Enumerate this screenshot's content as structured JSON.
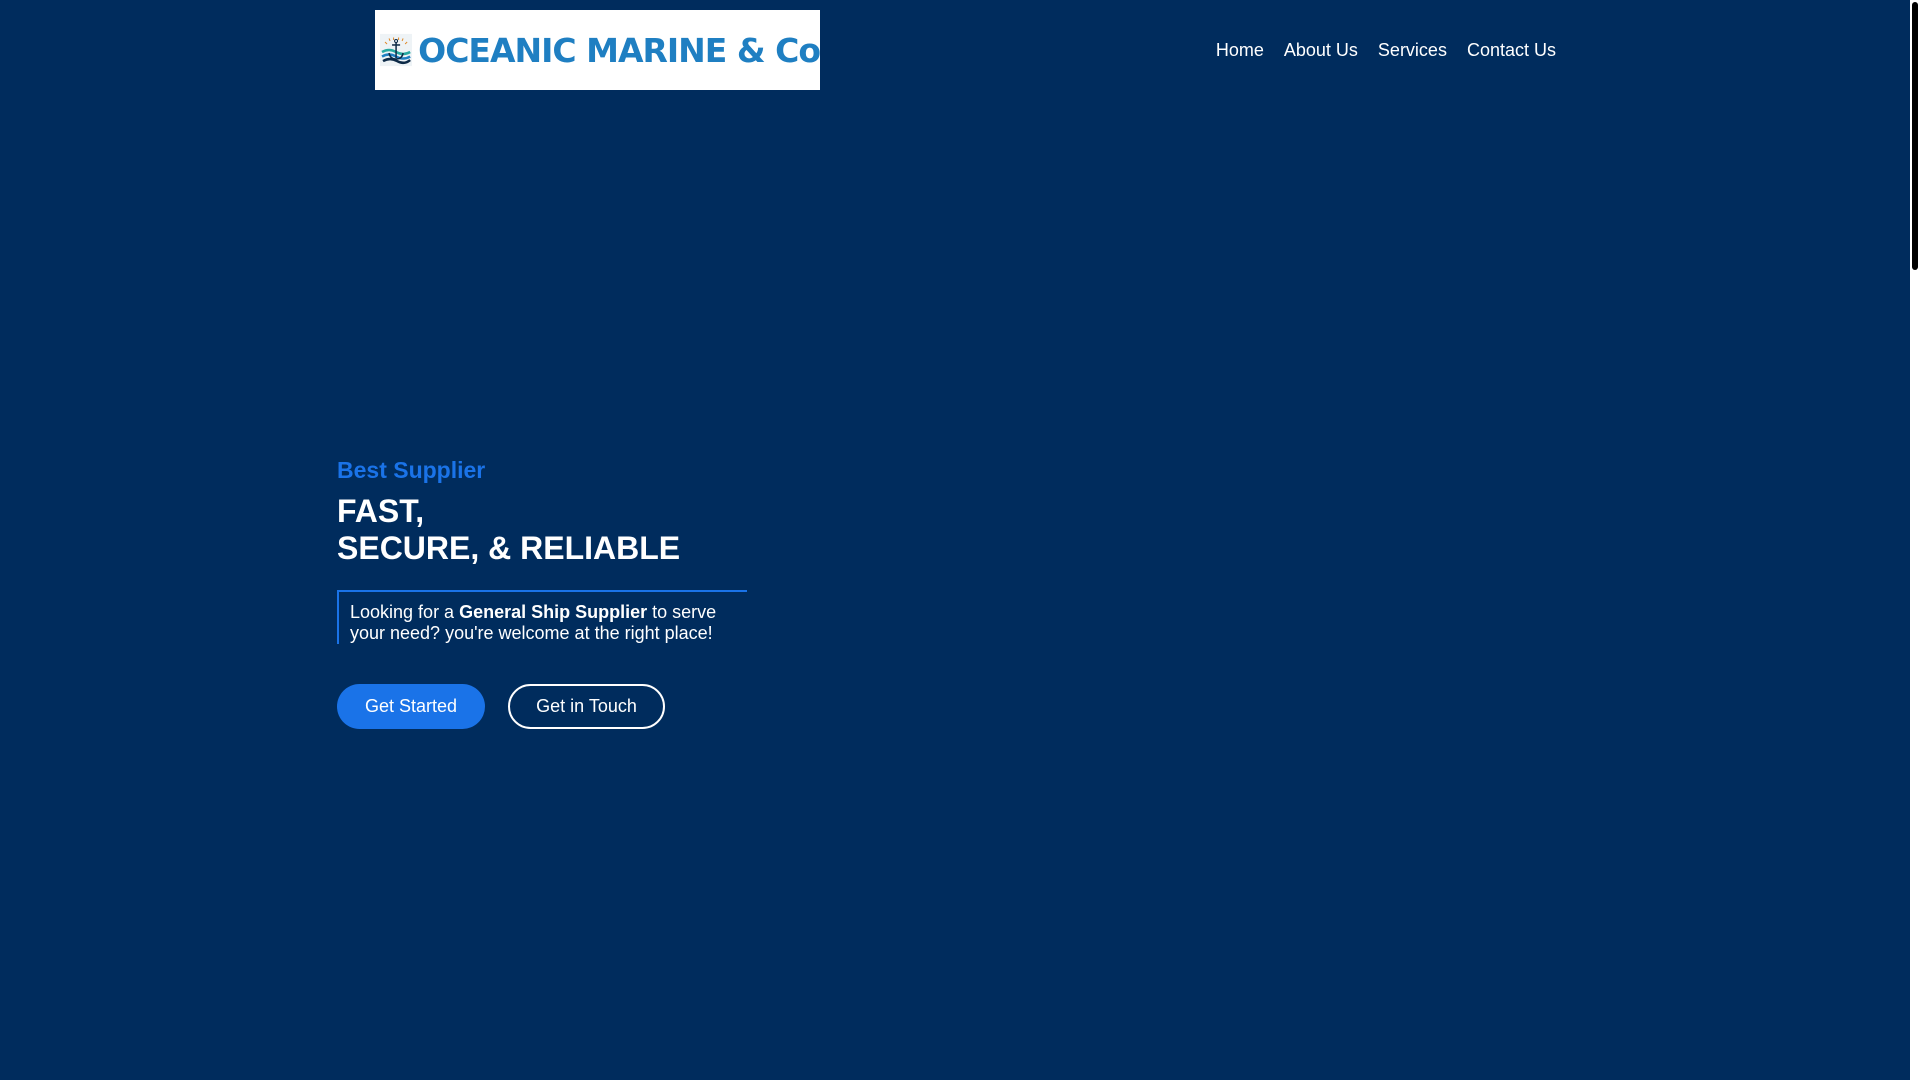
{
  "header": {
    "logo_text": "OCEANIC MARINE & Co",
    "nav": [
      {
        "label": "Home"
      },
      {
        "label": "About Us"
      },
      {
        "label": "Services"
      },
      {
        "label": "Contact Us"
      }
    ]
  },
  "hero": {
    "eyebrow": "Best Supplier",
    "headline_line1": "FAST,",
    "headline_line2": "SECURE, & RELIABLE",
    "callout_pre": "Looking for a ",
    "callout_bold": "General Ship Supplier",
    "callout_post": " to serve your need? you're welcome at the right place!",
    "primary_button": "Get Started",
    "secondary_button": "Get in Touch"
  },
  "colors": {
    "background": "#002c5d",
    "accent": "#1a73e8",
    "logo_text": "#1f7fc2"
  },
  "icons": {
    "logo": "anchor-waves-emblem"
  }
}
